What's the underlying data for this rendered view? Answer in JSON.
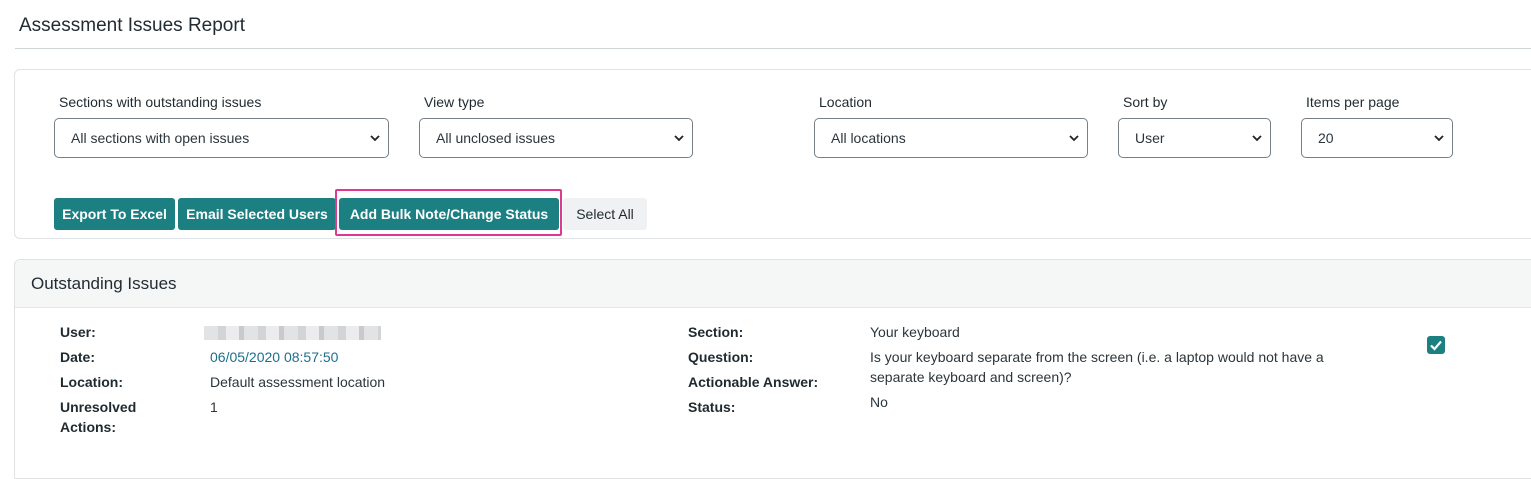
{
  "page": {
    "title": "Assessment Issues Report"
  },
  "filters": {
    "sections": {
      "label": "Sections with outstanding issues",
      "value": "All sections with open issues"
    },
    "view_type": {
      "label": "View type",
      "value": "All unclosed issues"
    },
    "location": {
      "label": "Location",
      "value": "All locations"
    },
    "sort_by": {
      "label": "Sort by",
      "value": "User"
    },
    "items_per_page": {
      "label": "Items per page",
      "value": "20"
    }
  },
  "actions": {
    "export": "Export To Excel",
    "email": "Email Selected Users",
    "bulk": "Add Bulk Note/Change Status",
    "select_all": "Select All"
  },
  "issues": {
    "title": "Outstanding Issues",
    "labels": {
      "user": "User:",
      "date": "Date:",
      "location": "Location:",
      "unresolved_1": "Unresolved",
      "unresolved_2": "Actions:",
      "section": "Section:",
      "question": "Question:",
      "actionable": "Actionable Answer:",
      "status": "Status:"
    },
    "item": {
      "date": "06/05/2020 08:57:50",
      "location": "Default assessment location",
      "unresolved": "1",
      "section": "Your keyboard",
      "question_line1": "Is your keyboard separate from the screen (i.e. a laptop would not have a",
      "question_line2": "separate keyboard and screen)?",
      "answer": "No",
      "selected": true
    }
  },
  "colors": {
    "accent": "#1c7f82",
    "highlight": "#e0388f"
  },
  "icons": {
    "chevron": "chevron-down-icon",
    "check": "check-icon"
  }
}
